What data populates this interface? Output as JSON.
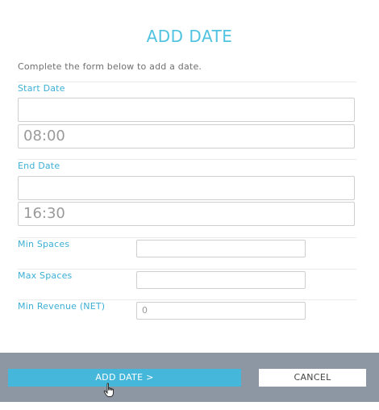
{
  "dialog": {
    "title": "ADD DATE",
    "intro": "Complete the form below to add a date."
  },
  "start": {
    "label": "Start Date",
    "date_value": "",
    "time_value": "08:00"
  },
  "end": {
    "label": "End Date",
    "date_value": "",
    "time_value": "16:30"
  },
  "min_spaces": {
    "label": "Min Spaces",
    "value": ""
  },
  "max_spaces": {
    "label": "Max Spaces",
    "value": ""
  },
  "min_revenue": {
    "label": "Min Revenue (NET)",
    "value": "0"
  },
  "footer": {
    "add_label": "ADD DATE >",
    "cancel_label": "CANCEL"
  },
  "colors": {
    "accent": "#45b7da",
    "title": "#4fc3e0",
    "footer_bg": "#8d96a3"
  }
}
